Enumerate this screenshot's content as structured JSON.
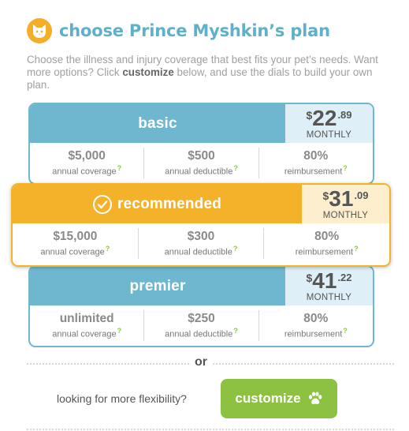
{
  "header": {
    "title": "choose Prince Myshkin’s plan",
    "icon": "cat-icon",
    "accent_color": "#f4ae2a",
    "title_color": "#5fb0c9"
  },
  "intro": {
    "before": "Choose the illness and injury coverage that best fits your pet’s needs. Want more options? Click ",
    "bold": "customize",
    "after": " below, and use the dials to build your own plan."
  },
  "plans": {
    "basic": {
      "name": "basic",
      "currency": "$",
      "price_dollars": "22",
      "price_cents": ".89",
      "period": "MONTHLY",
      "coverage_value": "$5,000",
      "coverage_label": "annual coverage",
      "deductible_value": "$500",
      "deductible_label": "annual deductible",
      "reimbursement_value": "80%",
      "reimbursement_label": "reimbursement"
    },
    "recommended": {
      "name": "recommended",
      "currency": "$",
      "price_dollars": "31",
      "price_cents": ".09",
      "period": "MONTHLY",
      "coverage_value": "$15,000",
      "coverage_label": "annual coverage",
      "deductible_value": "$300",
      "deductible_label": "annual deductible",
      "reimbursement_value": "80%",
      "reimbursement_label": "reimbursement"
    },
    "premier": {
      "name": "premier",
      "currency": "$",
      "price_dollars": "41",
      "price_cents": ".22",
      "period": "MONTHLY",
      "coverage_value": "unlimited",
      "coverage_label": "annual coverage",
      "deductible_value": "$250",
      "deductible_label": "annual deductible",
      "reimbursement_value": "80%",
      "reimbursement_label": "reimbursement"
    }
  },
  "help_marker": "?",
  "or_label": "or",
  "flexibility": {
    "prompt": "looking for more flexibility?",
    "button_label": "customize",
    "button_icon": "paw-icon",
    "button_color": "#8cc142"
  },
  "colors": {
    "blue": "#6fb7ce",
    "orange": "#f4b22a",
    "green_help": "#8dc641"
  }
}
